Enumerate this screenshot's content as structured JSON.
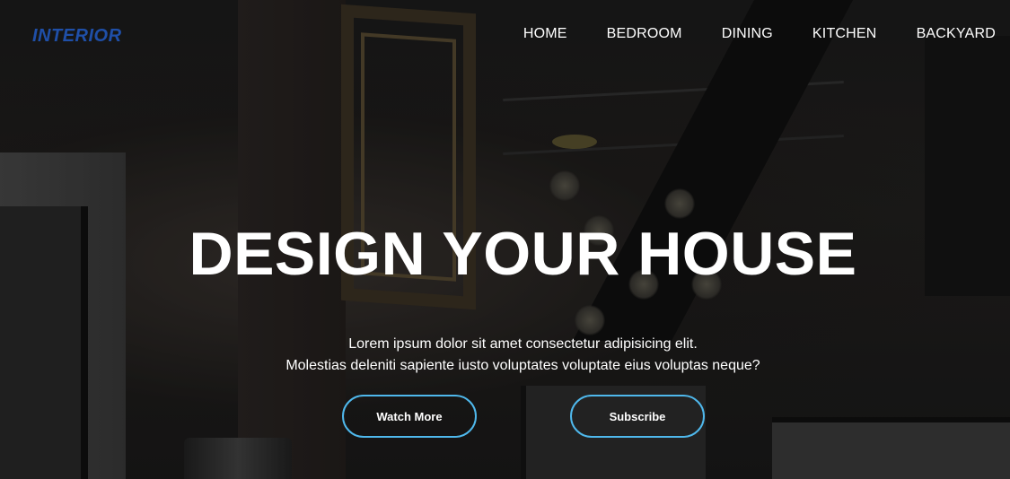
{
  "brand": {
    "logo_text": "INTERIOR",
    "logo_color": "#1f4fa8"
  },
  "nav": {
    "items": [
      {
        "label": "HOME"
      },
      {
        "label": "BEDROOM"
      },
      {
        "label": "DINING"
      },
      {
        "label": "KITCHEN"
      },
      {
        "label": "BACKYARD"
      }
    ]
  },
  "hero": {
    "headline": "DESIGN YOUR HOUSE",
    "description_line1": "Lorem ipsum dolor sit amet consectetur adipisicing elit.",
    "description_line2": "Molestias deleniti sapiente iusto voluptates voluptate eius voluptas neque?",
    "background_image": "dark-interior-photo",
    "buttons": {
      "watch_label": "Watch More",
      "subscribe_label": "Subscribe"
    },
    "button_border_color": "#4fb8ec"
  }
}
